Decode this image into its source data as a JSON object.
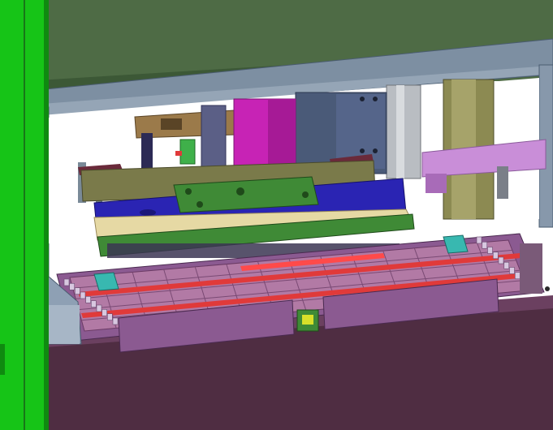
{
  "scene": {
    "subject": "cad-assembly-render",
    "colors": {
      "background": "#ffffff",
      "cabinet_top": "#4e6b45",
      "cabinet_dark": "#3c5836",
      "frame_steel": "#7d8fa2",
      "frame_edge": "#4a5c70",
      "side_panel_green": "#16c417",
      "lower_cabinet": "#4f2d42",
      "lower_front": "#5a3550",
      "conveyor_pink": "#b27aa5",
      "conveyor_cell": "#c893b8",
      "rail_purple": "#8b5a91",
      "blue_plate": "#2a24b3",
      "green_plate": "#3f8a36",
      "cream_plate": "#e6d9a4",
      "magenta_cylinder": "#c723b5",
      "steel_rod": "#5b5f86",
      "tan_block": "#9b7a4a",
      "olive_post": "#8c8a52",
      "lilac_rail": "#c98ed8",
      "cyan_block": "#38b8b0",
      "red_rod": "#e03a3a"
    }
  }
}
